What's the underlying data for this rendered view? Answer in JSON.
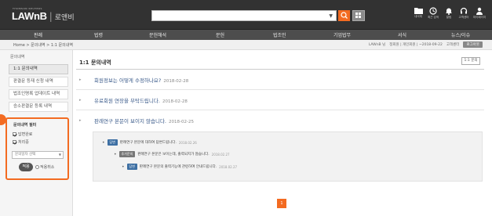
{
  "header": {
    "logo_sub": "THOMSON REUTERS",
    "logo_main": "LAWnB",
    "logo_sep": "|",
    "logo_kor": "로앤비",
    "search": {
      "value": "",
      "placeholder": ""
    },
    "tools": [
      {
        "icon": "folder-icon",
        "label": "내서재"
      },
      {
        "icon": "history-icon",
        "label": "최근 검색"
      },
      {
        "icon": "bell-icon",
        "label": "알림"
      },
      {
        "icon": "headset-icon",
        "label": "고객센터"
      },
      {
        "icon": "user-icon",
        "label": "마이페이지"
      }
    ]
  },
  "nav": {
    "items": [
      "판례",
      "법령",
      "문헌해석",
      "문헌",
      "법조인",
      "기업법무",
      "서식",
      "뉴스/이슈"
    ]
  },
  "breadcrumb": {
    "text": "Home > 문의내역 > 1:1 문의내역",
    "user_name": "LAWnB 님",
    "member_info": "정회원 | 개인회원 | ~2018-09-22",
    "account": "고객센터",
    "logout": "로그아웃"
  },
  "sidebar": {
    "title": "문의내역",
    "items": [
      {
        "label": "1:1 문의내역",
        "active": true
      },
      {
        "label": "판결문 등재 신청 내역",
        "active": false
      },
      {
        "label": "법조인명록 업데이트 내역",
        "active": false
      },
      {
        "label": "승소판결문 등록 내역",
        "active": false
      }
    ],
    "filter": {
      "title": "문의내역 필터",
      "option1": "답변완료",
      "option1_checked": true,
      "option2": "처리중",
      "option2_checked": true,
      "select_value": "문의일자 선택",
      "apply": "적용",
      "reset": "적용취소"
    }
  },
  "main": {
    "title": "1:1 문의내역",
    "inquiry_button": "1:1 문의",
    "questions": [
      {
        "text": "회원정보는 어떻게 수정하나요?",
        "date": "2018-02-28"
      },
      {
        "text": "유료회원 연장을 부탁드립니다.",
        "date": "2018-02-28"
      },
      {
        "text": "판례연구 본문이 보이지 않습니다.",
        "date": "2018-02-25"
      }
    ],
    "answers": [
      {
        "tag": "답변",
        "text": "판례연구 본문에 대하여 답변드립니다.",
        "date": "2018.02.26"
      },
      {
        "tag": "추가문의",
        "text": "판례연구 본문은 보이는데, 출력되지가 않습니다.",
        "date": "2018.02.27"
      },
      {
        "tag": "답변",
        "text": "판례연구 본문의 출력기능에 관련하여 안내드립니다.",
        "date": "2018.02.27"
      }
    ],
    "page": "1"
  },
  "colors": {
    "accent": "#f36b21",
    "topbar": "#323232",
    "navbar": "#4d4d4d",
    "link": "#3a5a8a"
  }
}
